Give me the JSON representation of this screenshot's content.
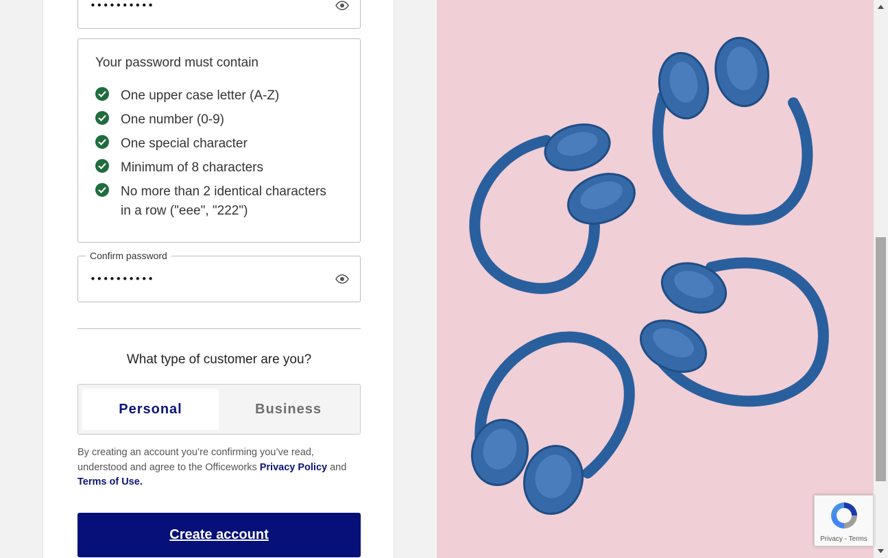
{
  "password": {
    "masked_value": "••••••••••",
    "toggle_visibility_icon": "eye-icon"
  },
  "requirements": {
    "title": "Your password must contain",
    "items": [
      {
        "label": "One upper case letter (A-Z)",
        "met": true
      },
      {
        "label": "One number (0-9)",
        "met": true
      },
      {
        "label": "One special character",
        "met": true
      },
      {
        "label": "Minimum of 8 characters",
        "met": true
      },
      {
        "label_line1": "No more than 2 identical characters",
        "label_line2": "in a row (\"eee\", \"222\")",
        "met": true
      }
    ]
  },
  "confirm_password": {
    "label": "Confirm password",
    "masked_value": "••••••••••",
    "toggle_visibility_icon": "eye-icon"
  },
  "customer_type": {
    "question": "What type of customer are you?",
    "options": [
      "Personal",
      "Business"
    ],
    "selected": "Personal"
  },
  "terms": {
    "text_before": "By creating an account you’re confirming you’ve read, understood and agree to the Officeworks ",
    "privacy_link": "Privacy Policy",
    "text_middle": " and ",
    "terms_link": "Terms of Use."
  },
  "create_button_label": "Create account",
  "recaptcha": {
    "privacy": "Privacy",
    "separator": " - ",
    "terms": "Terms"
  },
  "colors": {
    "brand_navy": "#061078",
    "check_green": "#1f6d3d",
    "image_background": "#f0cfd6",
    "headphone_blue": "#2a5f9e"
  }
}
